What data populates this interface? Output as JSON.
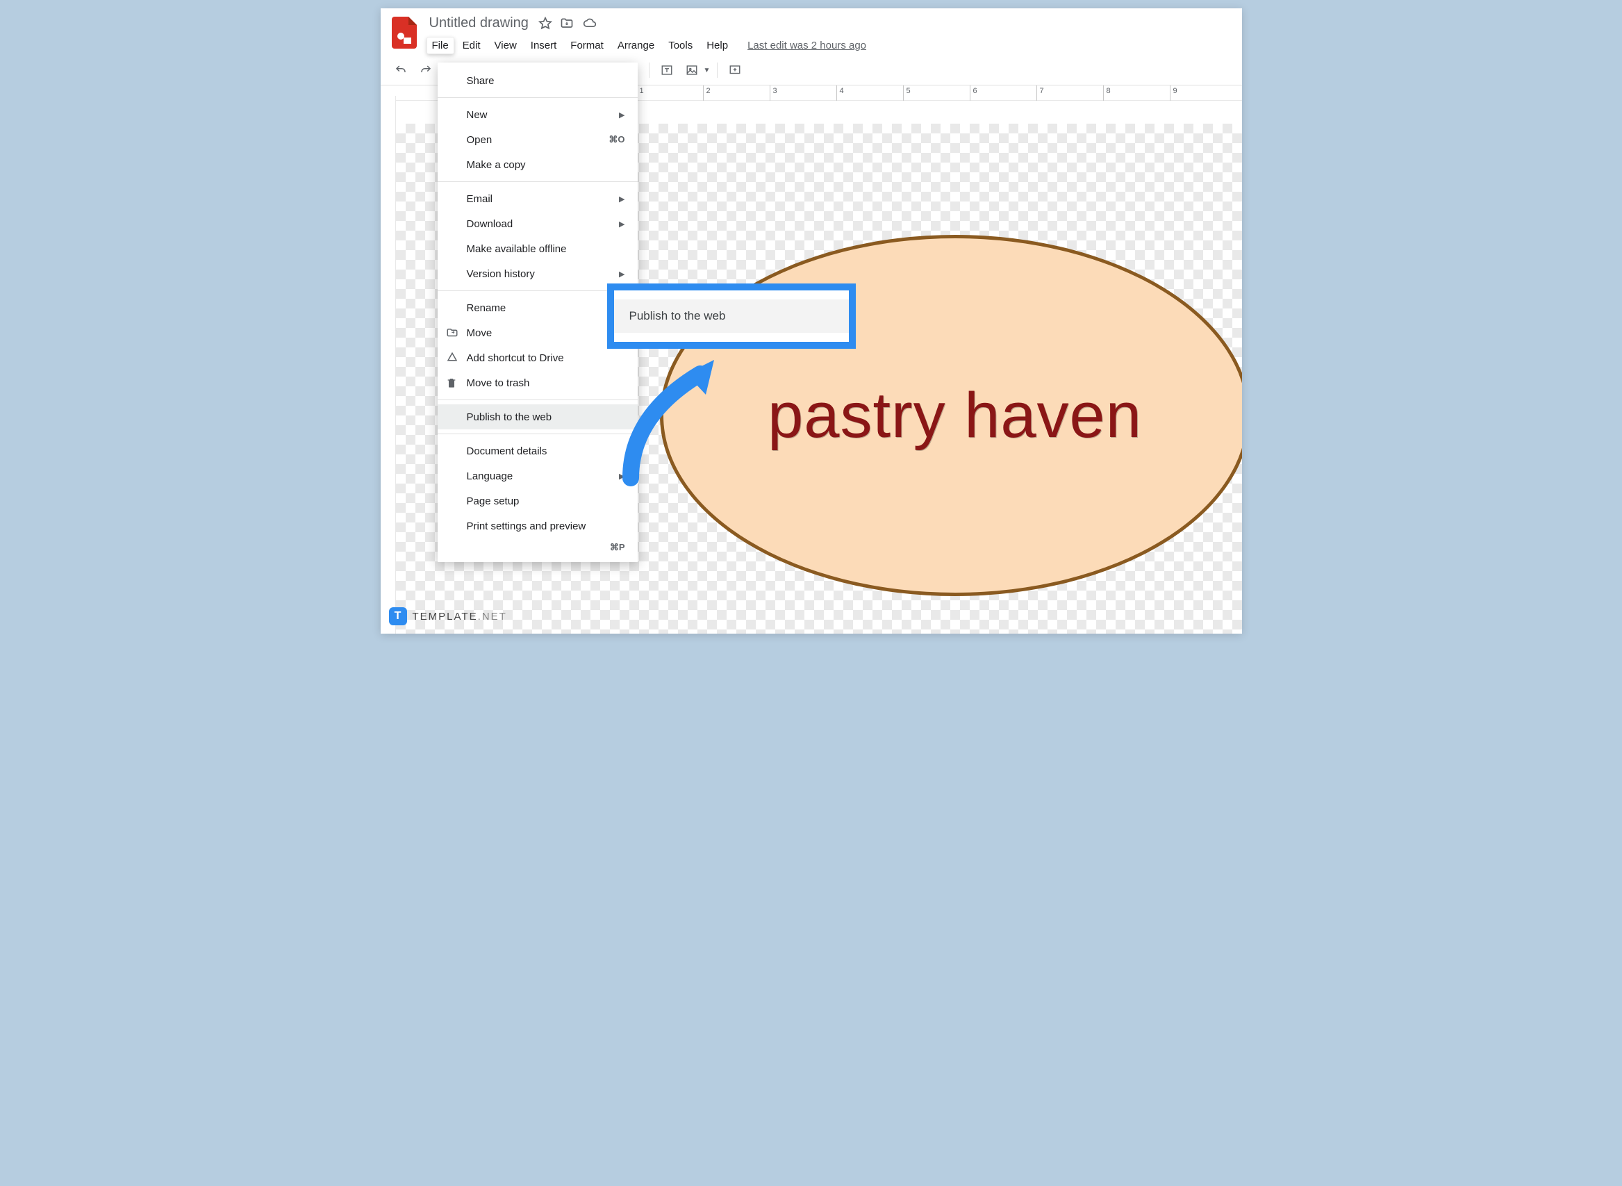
{
  "doc": {
    "title": "Untitled drawing"
  },
  "menubar": {
    "items": [
      "File",
      "Edit",
      "View",
      "Insert",
      "Format",
      "Arrange",
      "Tools",
      "Help"
    ],
    "last_edit": "Last edit was 2 hours ago"
  },
  "dropdown": {
    "share": "Share",
    "new": "New",
    "open": "Open",
    "open_shortcut": "⌘O",
    "make_copy": "Make a copy",
    "email": "Email",
    "download": "Download",
    "offline": "Make available offline",
    "version_history": "Version history",
    "rename": "Rename",
    "move": "Move",
    "add_shortcut": "Add shortcut to Drive",
    "trash": "Move to trash",
    "publish": "Publish to the web",
    "doc_details": "Document details",
    "language": "Language",
    "page_setup": "Page setup",
    "print_preview": "Print settings and preview",
    "print_shortcut": "⌘P"
  },
  "callout": {
    "label": "Publish to the web"
  },
  "canvas": {
    "ellipse_text": "pastry haven"
  },
  "ruler": {
    "ticks": [
      "1",
      "2",
      "3",
      "4",
      "5",
      "6",
      "7",
      "8",
      "9"
    ]
  },
  "watermark": {
    "brand": "TEMPLATE",
    "suffix": ".NET",
    "logo_letter": "T"
  }
}
